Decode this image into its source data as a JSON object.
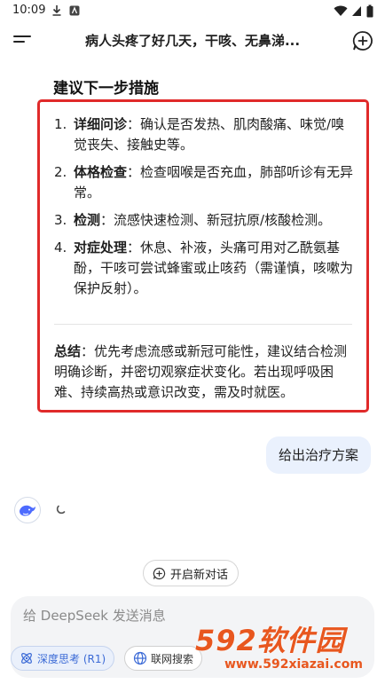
{
  "status_bar": {
    "time": "10:09"
  },
  "header": {
    "title": "病人头疼了好几天，干咳、无鼻涕..."
  },
  "answer": {
    "heading": "建议下一步措施",
    "steps": [
      {
        "num": "1.",
        "term": "详细问诊",
        "text": "：确认是否发热、肌肉酸痛、味觉/嗅觉丧失、接触史等。"
      },
      {
        "num": "2.",
        "term": "体格检查",
        "text": "：检查咽喉是否充血，肺部听诊有无异常。"
      },
      {
        "num": "3.",
        "term": "检测",
        "text": "：流感快速检测、新冠抗原/核酸检测。"
      },
      {
        "num": "4.",
        "term": "对症处理",
        "text": "：休息、补液，头痛可用对乙酰氨基酚，干咳可尝试蜂蜜或止咳药（需谨慎，咳嗽为保护反射）。"
      }
    ],
    "summary": {
      "term": "总结",
      "text": "：优先考虑流感或新冠可能性，建议结合检测明确诊断，并密切观察症状变化。若出现呼吸困难、持续高热或意识改变，需及时就医。"
    }
  },
  "user_message": "给出治疗方案",
  "new_conversation_label": "开启新对话",
  "composer": {
    "placeholder": "给 DeepSeek 发送消息",
    "deep_think_label": "深度思考 (R1)",
    "web_search_label": "联网搜索"
  },
  "watermark": {
    "brand": "592软件园",
    "url": "www.592xiazai.com"
  },
  "colors": {
    "highlight_border": "#e02a2a",
    "accent": "#3b6ad6",
    "user_bubble": "#eaf1fd",
    "watermark": "#e8571f"
  }
}
